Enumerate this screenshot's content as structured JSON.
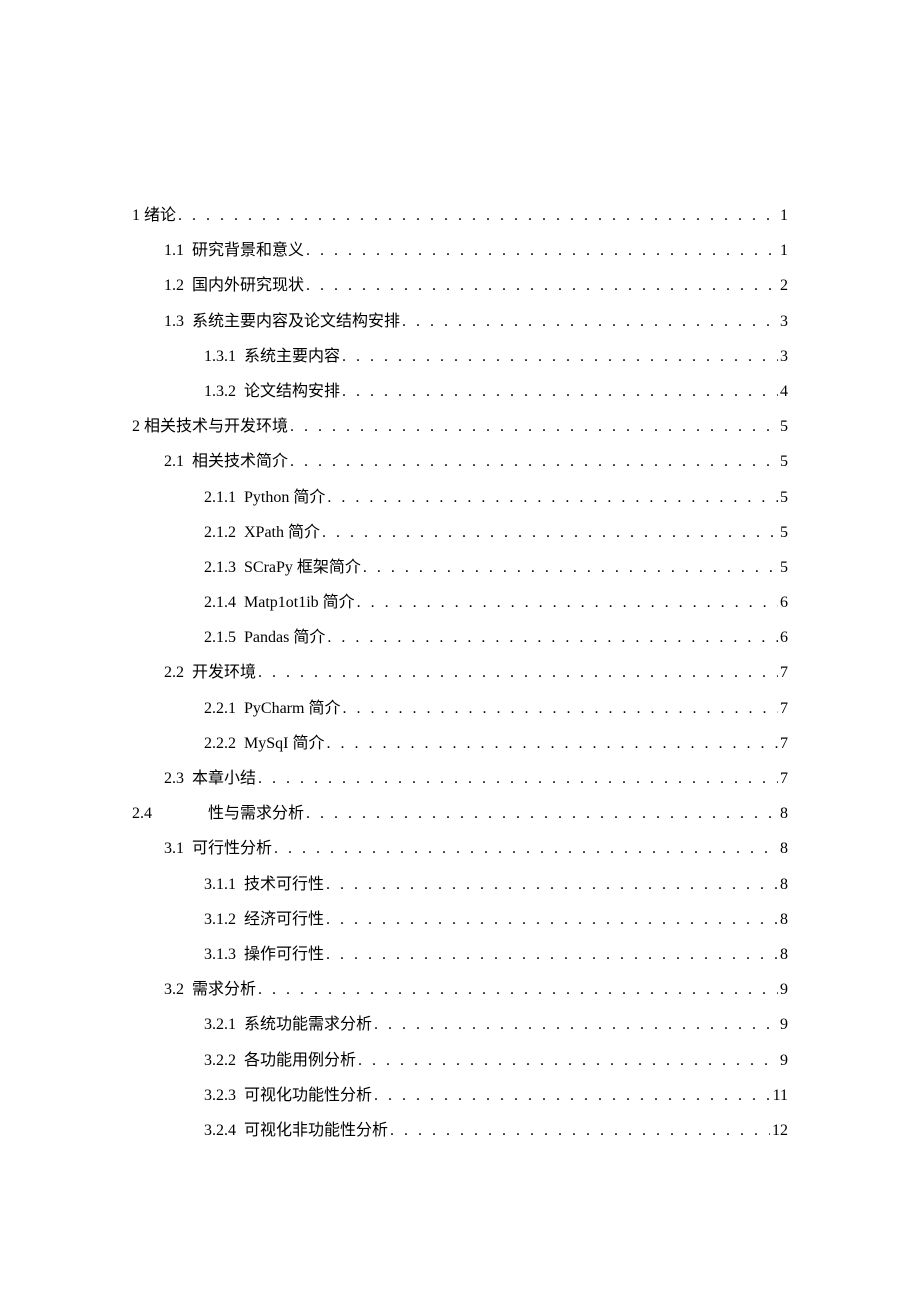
{
  "toc": [
    {
      "level": 0,
      "num": "1",
      "title": "绪论",
      "page": "1"
    },
    {
      "level": 1,
      "num": "1.1",
      "title": "研究背景和意义",
      "page": "1"
    },
    {
      "level": 1,
      "num": "1.2",
      "title": "国内外研究现状",
      "page": "2"
    },
    {
      "level": 1,
      "num": "1.3",
      "title": "系统主要内容及论文结构安排",
      "page": "3"
    },
    {
      "level": 2,
      "num": "1.3.1",
      "title": "系统主要内容",
      "page": "3"
    },
    {
      "level": 2,
      "num": "1.3.2",
      "title": "论文结构安排",
      "page": "4"
    },
    {
      "level": 0,
      "num": "2",
      "title": "相关技术与开发环境",
      "page": "5"
    },
    {
      "level": 1,
      "num": "2.1",
      "title": "相关技术简介",
      "page": "5"
    },
    {
      "level": 2,
      "num": "2.1.1",
      "title": "Python 简介",
      "page": "5"
    },
    {
      "level": 2,
      "num": "2.1.2",
      "title": "XPath 简介",
      "page": "5"
    },
    {
      "level": 2,
      "num": "2.1.3",
      "title": "SCraPy 框架简介",
      "page": "5"
    },
    {
      "level": 2,
      "num": "2.1.4",
      "title": "Matp1ot1ib 简介",
      "page": "6"
    },
    {
      "level": 2,
      "num": "2.1.5",
      "title": "Pandas 简介",
      "page": "6"
    },
    {
      "level": 1,
      "num": "2.2",
      "title": "开发环境",
      "page": "7"
    },
    {
      "level": 2,
      "num": "2.2.1",
      "title": "PyCharm 简介",
      "page": "7"
    },
    {
      "level": 2,
      "num": "2.2.2",
      "title": "MySqI 简介",
      "page": "7"
    },
    {
      "level": 1,
      "num": "2.3",
      "title": "本章小结",
      "page": "7"
    },
    {
      "level": -1,
      "num": "2.4",
      "title": "性与需求分析",
      "page": "8"
    },
    {
      "level": 1,
      "num": "3.1",
      "title": "可行性分析",
      "page": "8"
    },
    {
      "level": 2,
      "num": "3.1.1",
      "title": "技术可行性",
      "page": "8"
    },
    {
      "level": 2,
      "num": "3.1.2",
      "title": "经济可行性",
      "page": "8"
    },
    {
      "level": 2,
      "num": "3.1.3",
      "title": "操作可行性",
      "page": "8"
    },
    {
      "level": 1,
      "num": "3.2",
      "title": "需求分析",
      "page": "9"
    },
    {
      "level": 2,
      "num": "3.2.1",
      "title": "系统功能需求分析",
      "page": "9"
    },
    {
      "level": 2,
      "num": "3.2.2",
      "title": "各功能用例分析",
      "page": "9"
    },
    {
      "level": 2,
      "num": "3.2.3",
      "title": "可视化功能性分析",
      "page": "11"
    },
    {
      "level": 2,
      "num": "3.2.4",
      "title": "可视化非功能性分析",
      "page": "12"
    }
  ]
}
